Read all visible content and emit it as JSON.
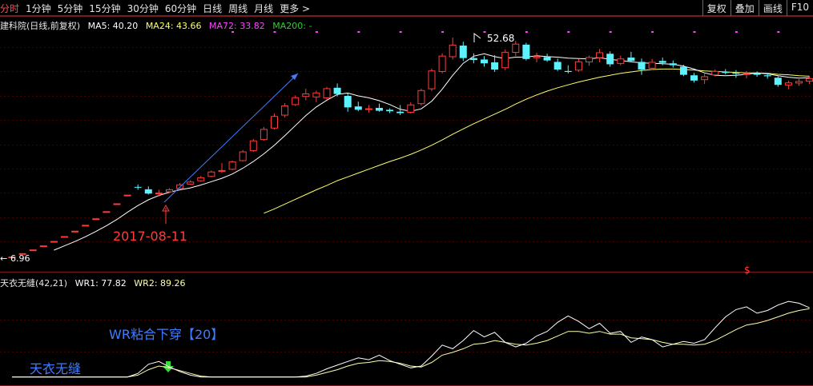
{
  "toolbar": {
    "tabs": [
      "分时",
      "1分钟",
      "5分钟",
      "15分钟",
      "30分钟",
      "60分钟",
      "日线",
      "周线",
      "月线"
    ],
    "active_index": 0,
    "more_label": "更多",
    "more_icon": "chevron-right-icon",
    "tools": [
      "复权",
      "叠加",
      "画线",
      "F10"
    ]
  },
  "main_legend": {
    "stock_title": "建科院(日线,前复权)",
    "ma5": "MA5: 40.20",
    "ma24": "MA24: 43.66",
    "ma72": "MA72: 33.82",
    "ma200": "MA200: -",
    "colors": {
      "ma5": "#ffffff",
      "ma24": "#ffff66",
      "ma72": "#ff44ff",
      "ma200": "#33cc33"
    }
  },
  "sub_legend": {
    "title": "天衣无缝(42,21)",
    "wr1": "WR1: 77.82",
    "wr2": "WR2: 89.26"
  },
  "annotations": {
    "high_label": "52.68",
    "low_label": "6.96",
    "date_label": "2017-08-11",
    "signal_label": "WR粘合下穿【20】",
    "indicator_name": "天衣无缝",
    "dollar_mark": "$"
  },
  "colors": {
    "up": "#ff3b3b",
    "down": "#5cf2ff",
    "grid": "#4a0000",
    "axis": "#7a1a1a"
  },
  "chart_data": [
    {
      "type": "candlestick",
      "title": "建科院(日线,前复权)",
      "yrange": [
        6.96,
        52.68
      ],
      "ohlc": [
        [
          6.96,
          6.96,
          6.96,
          6.96
        ],
        [
          7.66,
          7.66,
          7.66,
          7.66
        ],
        [
          8.43,
          8.43,
          8.43,
          8.43
        ],
        [
          9.27,
          9.27,
          9.27,
          9.27
        ],
        [
          10.2,
          10.2,
          10.2,
          10.2
        ],
        [
          11.22,
          11.22,
          11.22,
          11.22
        ],
        [
          12.34,
          12.34,
          12.34,
          12.34
        ],
        [
          13.57,
          13.57,
          13.57,
          13.57
        ],
        [
          14.93,
          14.93,
          14.93,
          14.93
        ],
        [
          16.42,
          16.42,
          16.42,
          16.42
        ],
        [
          18.06,
          18.06,
          18.06,
          18.06
        ],
        [
          19.87,
          19.87,
          19.87,
          19.87
        ],
        [
          21.5,
          22.0,
          20.9,
          21.4
        ],
        [
          21.0,
          21.6,
          19.9,
          20.1
        ],
        [
          20.2,
          20.9,
          19.5,
          20.3
        ],
        [
          20.4,
          21.2,
          20.2,
          21.0
        ],
        [
          21.1,
          22.3,
          21.1,
          22.0
        ],
        [
          22.0,
          22.9,
          21.9,
          22.6
        ],
        [
          22.7,
          23.8,
          22.6,
          23.5
        ],
        [
          23.6,
          24.9,
          23.5,
          24.7
        ],
        [
          24.8,
          26.5,
          24.4,
          25.0
        ],
        [
          25.1,
          27.0,
          25.0,
          26.8
        ],
        [
          26.9,
          29.2,
          26.8,
          28.9
        ],
        [
          29.0,
          31.5,
          28.8,
          31.2
        ],
        [
          31.3,
          34.0,
          31.1,
          33.6
        ],
        [
          33.7,
          36.8,
          33.5,
          36.3
        ],
        [
          36.4,
          39.0,
          36.0,
          38.5
        ],
        [
          38.6,
          40.6,
          38.4,
          40.2
        ],
        [
          40.3,
          42.0,
          39.6,
          41.0
        ],
        [
          40.2,
          41.6,
          39.2,
          41.2
        ],
        [
          40.0,
          42.4,
          39.7,
          42.1
        ],
        [
          42.2,
          43.1,
          40.4,
          40.9
        ],
        [
          40.5,
          41.0,
          37.2,
          38.1
        ],
        [
          38.3,
          39.3,
          37.3,
          37.6
        ],
        [
          37.6,
          38.6,
          37.0,
          37.9
        ],
        [
          38.0,
          38.9,
          37.2,
          37.4
        ],
        [
          37.6,
          37.9,
          36.9,
          37.3
        ],
        [
          37.2,
          38.6,
          36.5,
          36.9
        ],
        [
          37.0,
          39.2,
          36.8,
          38.7
        ],
        [
          38.8,
          42.0,
          38.5,
          41.7
        ],
        [
          41.9,
          46.2,
          41.5,
          45.8
        ],
        [
          45.5,
          49.4,
          45.2,
          48.9
        ],
        [
          48.6,
          52.68,
          48.1,
          51.2
        ],
        [
          51.0,
          51.8,
          47.8,
          48.4
        ],
        [
          48.4,
          49.4,
          47.3,
          48.0
        ],
        [
          48.1,
          48.8,
          46.6,
          47.3
        ],
        [
          47.5,
          49.0,
          45.5,
          46.0
        ],
        [
          46.3,
          50.2,
          45.9,
          49.7
        ],
        [
          49.5,
          52.0,
          48.8,
          51.4
        ],
        [
          51.2,
          51.6,
          47.9,
          48.2
        ],
        [
          48.4,
          49.5,
          47.5,
          48.8
        ],
        [
          48.6,
          49.3,
          47.6,
          47.9
        ],
        [
          47.6,
          48.3,
          45.7,
          46.0
        ],
        [
          45.7,
          46.9,
          45.2,
          45.5
        ],
        [
          45.8,
          48.2,
          45.5,
          47.7
        ],
        [
          47.5,
          48.9,
          46.8,
          48.6
        ],
        [
          48.4,
          50.3,
          47.5,
          49.6
        ],
        [
          49.3,
          49.8,
          46.6,
          47.1
        ],
        [
          47.2,
          48.9,
          46.9,
          48.3
        ],
        [
          48.5,
          49.7,
          47.6,
          47.8
        ],
        [
          47.6,
          48.3,
          44.9,
          46.0
        ],
        [
          46.2,
          48.2,
          45.9,
          47.6
        ],
        [
          47.8,
          48.5,
          46.9,
          47.4
        ],
        [
          47.3,
          47.9,
          46.4,
          46.9
        ],
        [
          46.6,
          47.0,
          44.6,
          44.9
        ],
        [
          44.8,
          45.3,
          43.3,
          43.7
        ],
        [
          43.8,
          45.1,
          43.0,
          44.6
        ],
        [
          44.8,
          46.0,
          44.6,
          45.7
        ],
        [
          45.5,
          46.1,
          45.0,
          45.3
        ],
        [
          45.3,
          45.9,
          44.3,
          45.1
        ],
        [
          45.0,
          45.7,
          44.2,
          45.2
        ],
        [
          45.2,
          45.6,
          44.5,
          44.9
        ],
        [
          44.8,
          45.2,
          44.1,
          44.6
        ],
        [
          44.3,
          44.6,
          42.4,
          42.8
        ],
        [
          42.7,
          43.7,
          41.9,
          43.3
        ],
        [
          43.1,
          44.0,
          42.6,
          43.6
        ],
        [
          43.5,
          44.5,
          43.0,
          44.2
        ]
      ],
      "ma5": [
        null,
        null,
        null,
        null,
        8.3,
        9.2,
        10.1,
        11.1,
        12.2,
        13.4,
        14.7,
        16.2,
        17.6,
        18.8,
        19.7,
        20.4,
        20.9,
        21.3,
        21.9,
        22.6,
        23.3,
        24.2,
        25.4,
        26.8,
        28.4,
        30.2,
        32.2,
        34.3,
        36.4,
        38.2,
        39.6,
        40.8,
        41.1,
        40.5,
        40.1,
        39.5,
        38.7,
        37.7,
        37.3,
        37.8,
        39.4,
        41.9,
        44.8,
        47.3,
        48.8,
        49.3,
        48.7,
        48.3,
        48.6,
        48.6,
        48.9,
        48.7,
        48.6,
        48.4,
        48.3,
        48.2,
        48.5,
        48.1,
        47.9,
        47.6,
        47.4,
        47.3,
        47.2,
        47.1,
        46.7,
        46.1,
        45.3,
        44.8,
        44.7,
        44.8,
        45.0,
        45.3,
        45.1,
        44.7,
        44.4,
        44.2,
        44.3
      ],
      "ma24": [
        null,
        null,
        null,
        null,
        null,
        null,
        null,
        null,
        null,
        null,
        null,
        null,
        null,
        null,
        null,
        null,
        null,
        null,
        null,
        null,
        null,
        null,
        null,
        null,
        16.0,
        16.9,
        17.9,
        18.9,
        19.9,
        20.9,
        21.8,
        22.8,
        23.6,
        24.4,
        25.2,
        26.0,
        26.8,
        27.5,
        28.3,
        29.2,
        30.2,
        31.3,
        32.5,
        33.6,
        34.7,
        35.7,
        36.7,
        37.7,
        38.8,
        39.8,
        40.7,
        41.5,
        42.2,
        42.8,
        43.4,
        43.9,
        44.4,
        44.8,
        45.2,
        45.5,
        45.8,
        46.0,
        46.1,
        46.1,
        46.0,
        45.9,
        45.7,
        45.6,
        45.5,
        45.4,
        45.3,
        45.3,
        45.2,
        45.0,
        44.9,
        44.7,
        44.6
      ]
    },
    {
      "type": "line",
      "title": "天衣无缝(42,21)",
      "yrange": [
        0,
        100
      ],
      "series": [
        {
          "name": "WR1",
          "color": "#ffffff",
          "values": [
            2,
            2,
            2,
            2,
            2,
            2,
            2,
            2,
            2,
            2,
            2,
            2,
            6,
            16,
            19,
            13,
            8,
            4,
            2,
            2,
            2,
            2,
            2,
            2,
            2,
            2,
            2,
            2,
            3,
            6,
            11,
            15,
            19,
            23,
            21,
            26,
            20,
            16,
            12,
            14,
            25,
            37,
            33,
            42,
            53,
            46,
            51,
            40,
            35,
            39,
            47,
            52,
            62,
            69,
            63,
            55,
            61,
            50,
            52,
            40,
            46,
            43,
            35,
            38,
            41,
            39,
            43,
            56,
            68,
            76,
            79,
            72,
            75,
            81,
            85,
            83,
            78
          ]
        },
        {
          "name": "WR2",
          "color": "#ffffaa",
          "values": [
            2,
            2,
            2,
            2,
            2,
            2,
            2,
            2,
            2,
            2,
            2,
            2,
            4,
            10,
            14,
            12,
            9,
            6,
            3,
            2,
            2,
            2,
            2,
            2,
            2,
            2,
            2,
            2,
            2,
            4,
            7,
            10,
            14,
            17,
            18,
            20,
            19,
            17,
            14,
            13,
            18,
            26,
            29,
            33,
            38,
            39,
            42,
            40,
            38,
            37,
            39,
            42,
            47,
            52,
            52,
            50,
            52,
            49,
            49,
            45,
            44,
            43,
            40,
            38,
            38,
            37,
            38,
            42,
            48,
            54,
            59,
            61,
            64,
            68,
            72,
            75,
            77
          ]
        }
      ]
    }
  ]
}
